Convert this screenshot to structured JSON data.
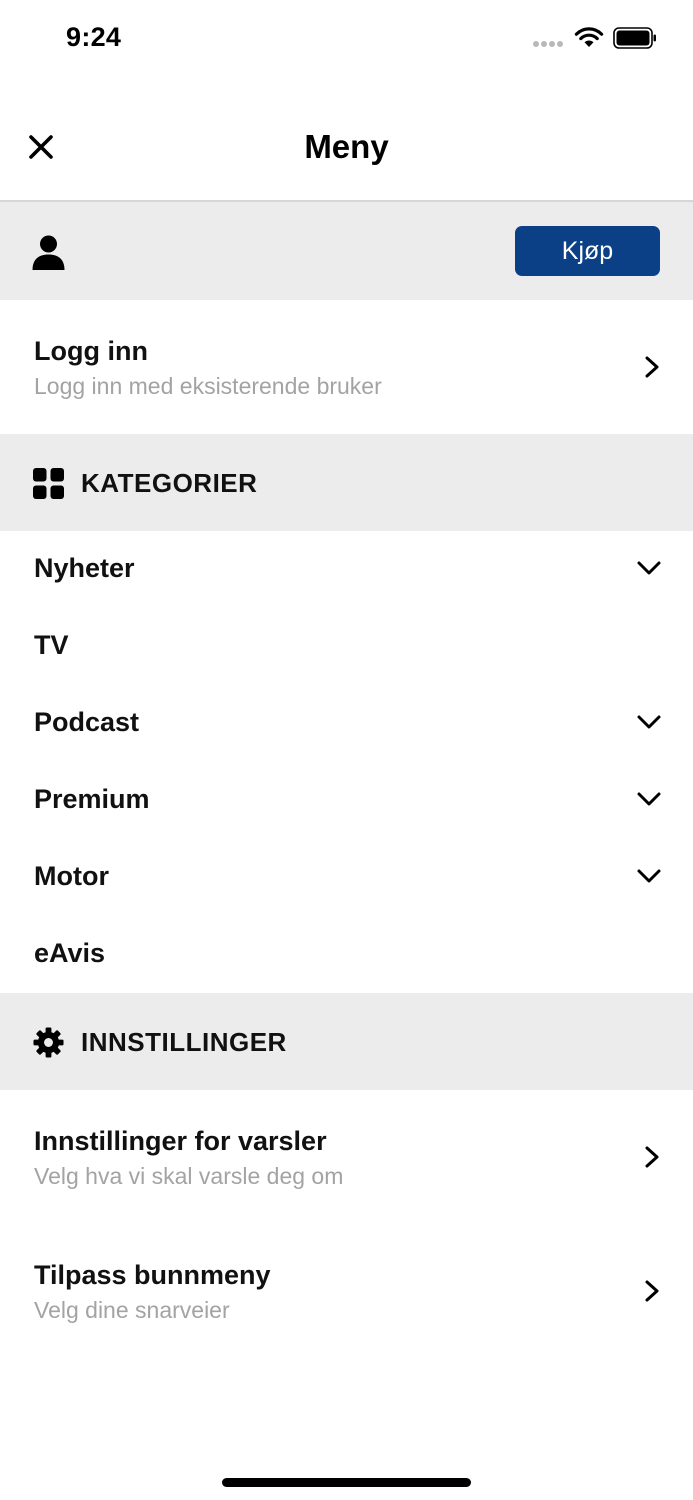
{
  "status_bar": {
    "time": "9:24"
  },
  "header": {
    "title": "Meny",
    "close_icon": "close-icon"
  },
  "account": {
    "buy_label": "Kjøp",
    "user_icon": "user-icon"
  },
  "login": {
    "title": "Logg inn",
    "subtitle": "Logg inn med eksisterende bruker"
  },
  "categories": {
    "heading": "KATEGORIER",
    "icon": "grid-icon",
    "items": [
      {
        "label": "Nyheter",
        "expandable": true
      },
      {
        "label": "TV",
        "expandable": false
      },
      {
        "label": "Podcast",
        "expandable": true
      },
      {
        "label": "Premium",
        "expandable": true
      },
      {
        "label": "Motor",
        "expandable": true
      },
      {
        "label": "eAvis",
        "expandable": false
      }
    ]
  },
  "settings": {
    "heading": "INNSTILLINGER",
    "icon": "gear-icon",
    "items": [
      {
        "title": "Innstillinger for varsler",
        "subtitle": "Velg hva vi skal varsle deg om"
      },
      {
        "title": "Tilpass bunnmeny",
        "subtitle": "Velg dine snarveier"
      }
    ]
  },
  "colors": {
    "accent": "#0b3f86",
    "band": "#ececec",
    "subtitle": "#a3a3a3"
  }
}
